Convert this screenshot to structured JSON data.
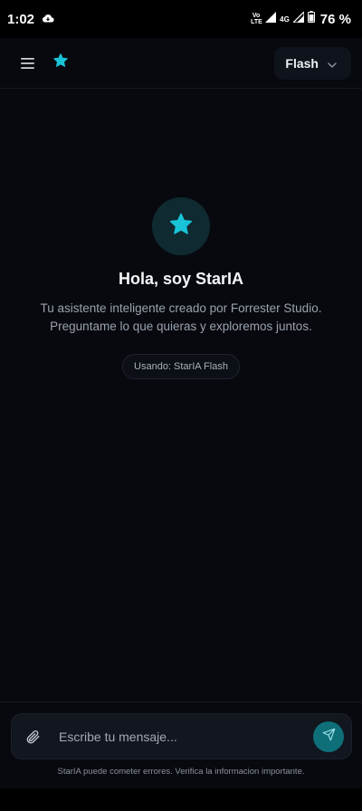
{
  "status_bar": {
    "time": "1:02",
    "volte": "Vo LTE",
    "network": "4G",
    "battery": "76 %"
  },
  "app_bar": {
    "model_label": "Flash"
  },
  "hero": {
    "title": "Hola, soy StarIA",
    "subtitle": "Tu asistente inteligente creado por Forrester Studio. Preguntame lo que quieras y exploremos juntos.",
    "using_label": "Usando: StarIA Flash"
  },
  "composer": {
    "placeholder": "Escribe tu mensaje...",
    "disclaimer": "StarIA puede cometer errores. Verifica la informacion importante."
  },
  "colors": {
    "accent": "#19c3d8",
    "background": "#07090f",
    "send_button": "#0e6f78"
  },
  "icons": [
    "cloud-icon",
    "signal-icon",
    "battery-icon",
    "menu-icon",
    "star-icon",
    "chevron-down-icon",
    "paperclip-icon",
    "send-icon"
  ]
}
